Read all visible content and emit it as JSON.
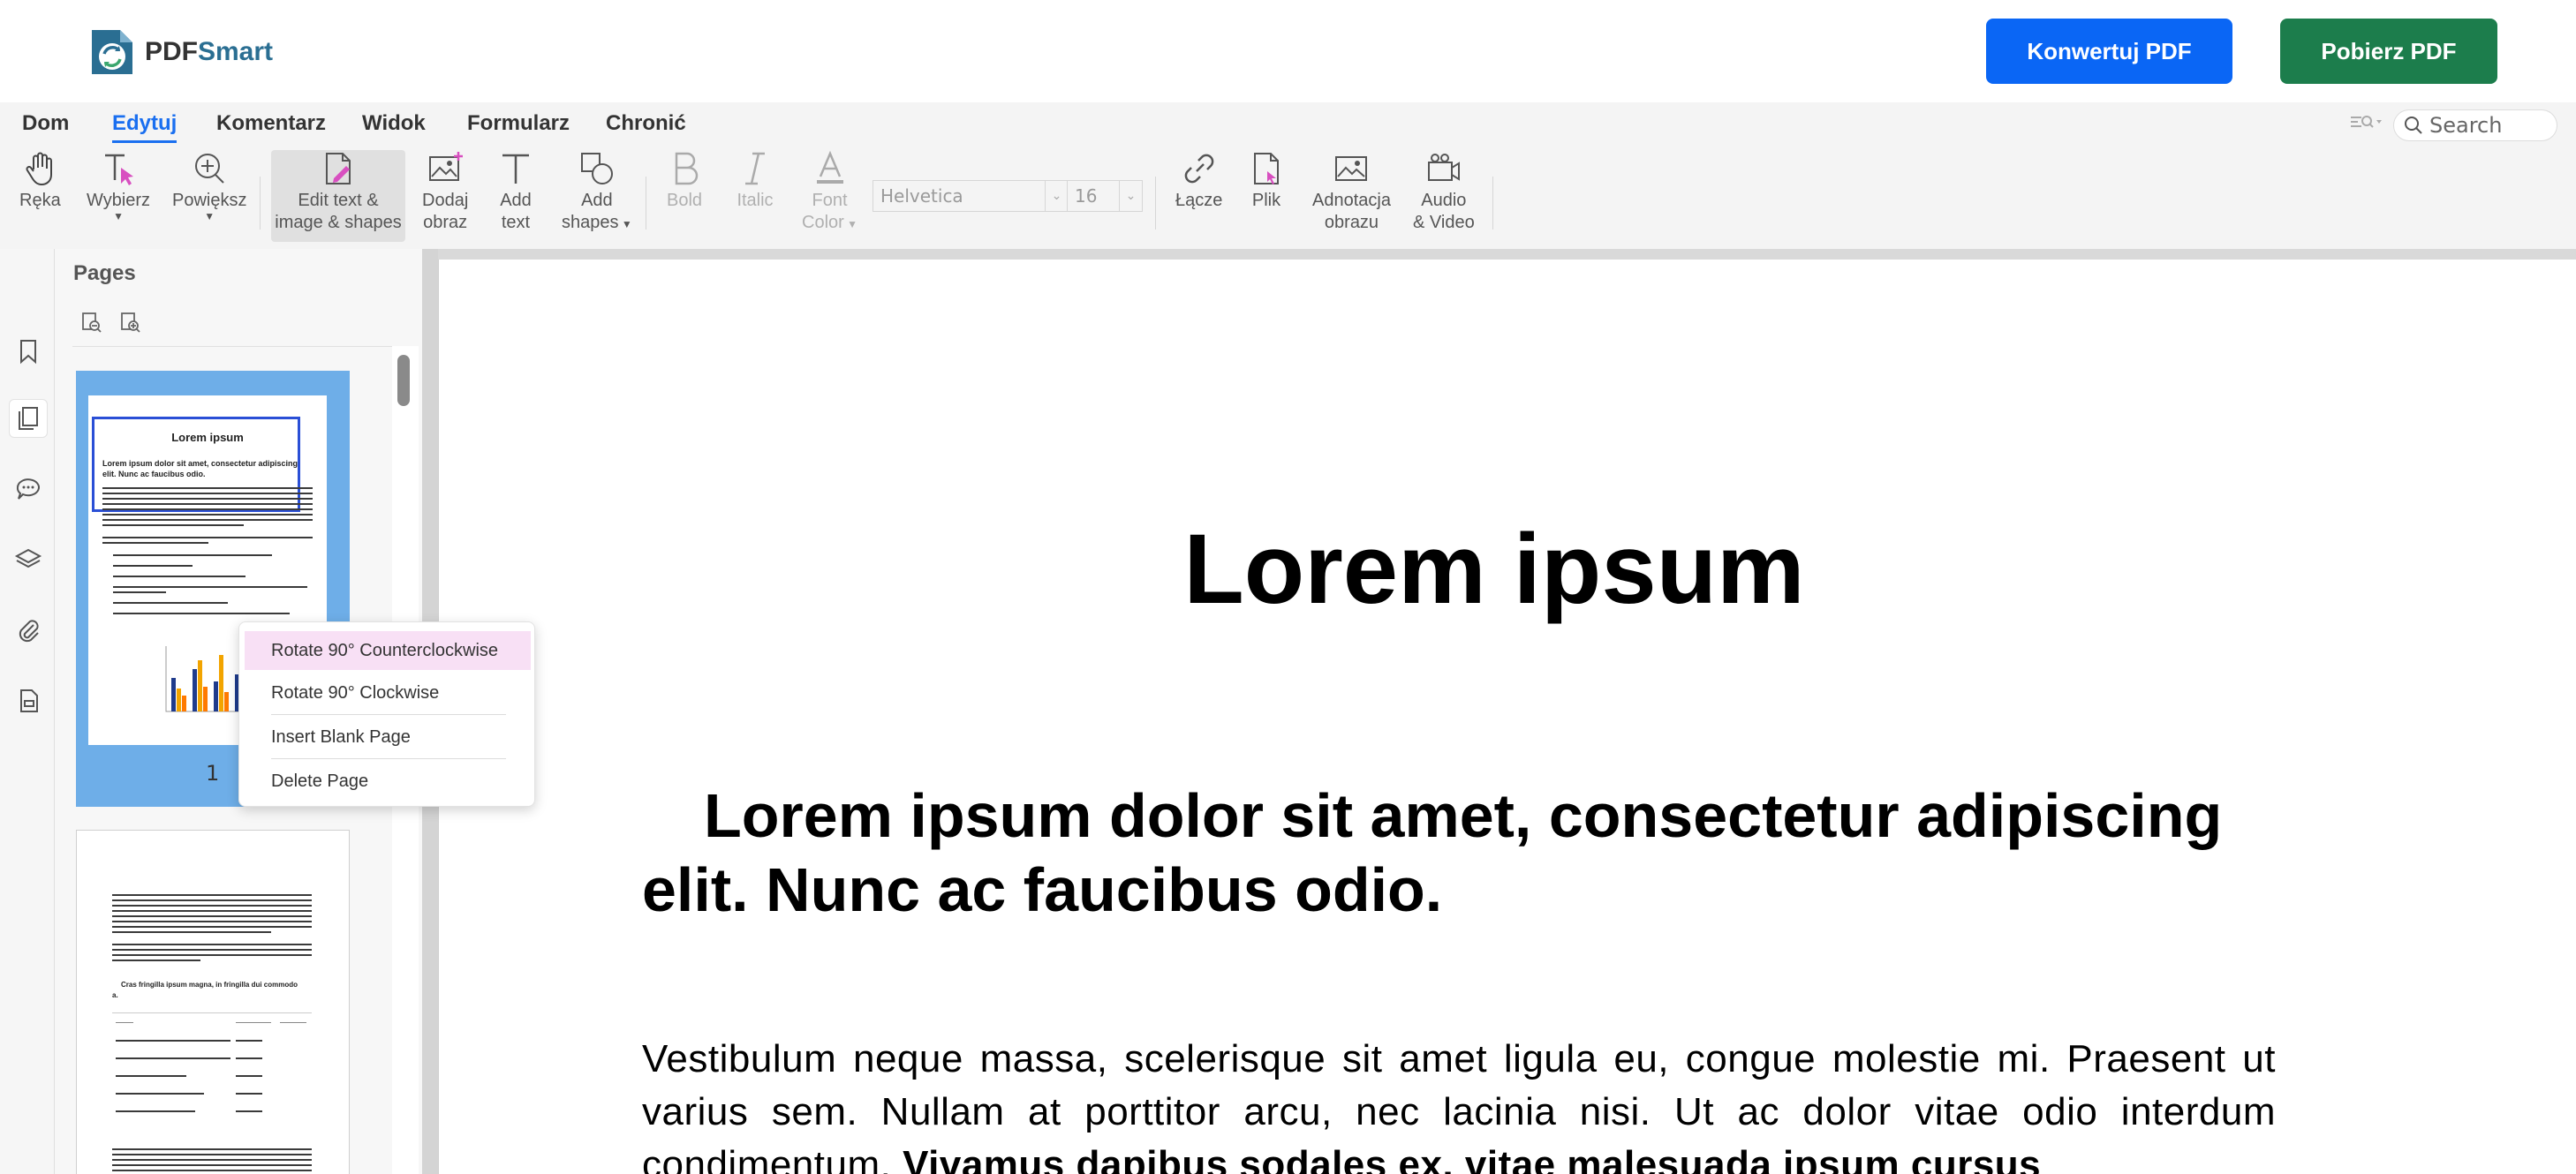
{
  "app": {
    "logo_part1": "PDF",
    "logo_part2": "Smart",
    "convert_button": "Konwertuj PDF",
    "download_button": "Pobierz PDF"
  },
  "menu": {
    "items": [
      "Dom",
      "Edytuj",
      "Komentarz",
      "Widok",
      "Formularz",
      "Chronić"
    ],
    "active": "Edytuj",
    "search_placeholder": "Search"
  },
  "toolbar": {
    "hand": "Ręka",
    "select": "Wybierz",
    "zoom": "Powiększ",
    "edit_line1": "Edit text &",
    "edit_line2": "image & shapes",
    "add_image_line1": "Dodaj",
    "add_image_line2": "obraz",
    "add_text_line1": "Add",
    "add_text_line2": "text",
    "add_shapes_line1": "Add",
    "add_shapes_line2": "shapes",
    "bold": "Bold",
    "italic": "Italic",
    "font_color_line1": "Font",
    "font_color_line2": "Color",
    "font_family": "Helvetica",
    "font_size": "16",
    "link": "Łącze",
    "file": "Plik",
    "image_annot_line1": "Adnotacja",
    "image_annot_line2": "obrazu",
    "audio_video_line1": "Audio",
    "audio_video_line2": "& Video"
  },
  "pages_panel": {
    "title": "Pages",
    "page1_number": "1",
    "page1_thumb_title": "Lorem ipsum",
    "page1_thumb_subtitle_line1": "Lorem ipsum dolor sit amet, consectetur adipiscing",
    "page1_thumb_subtitle_line2": "elit. Nunc ac faucibus odio.",
    "page2_thumb_heading": "Cras fringilla ipsum magna, in fringilla dui commodo",
    "page2_thumb_heading_line2": "a."
  },
  "context_menu": {
    "items": [
      "Rotate 90° Counterclockwise",
      "Rotate 90° Clockwise",
      "Insert Blank Page",
      "Delete Page"
    ]
  },
  "document": {
    "title": "Lorem ipsum",
    "subtitle": "Lorem ipsum dolor sit amet, consectetur adipiscing elit. Nunc ac faucibus odio.",
    "body_plain": "Vestibulum neque massa, scelerisque sit amet ligula eu, congue molestie mi. Praesent ut varius sem. Nullam at porttitor arcu, nec lacinia nisi. Ut ac dolor vitae odio interdum condimentum. ",
    "body_bold": "Vivamus dapibus sodales ex, vitae malesuada ipsum cursus"
  },
  "colors": {
    "convert_button": "#0a66f5",
    "download_button": "#1c7d4c",
    "active_menu": "#1a6ff0",
    "thumb_selected": "#6eaee8",
    "context_hover": "#f8e0f5"
  }
}
